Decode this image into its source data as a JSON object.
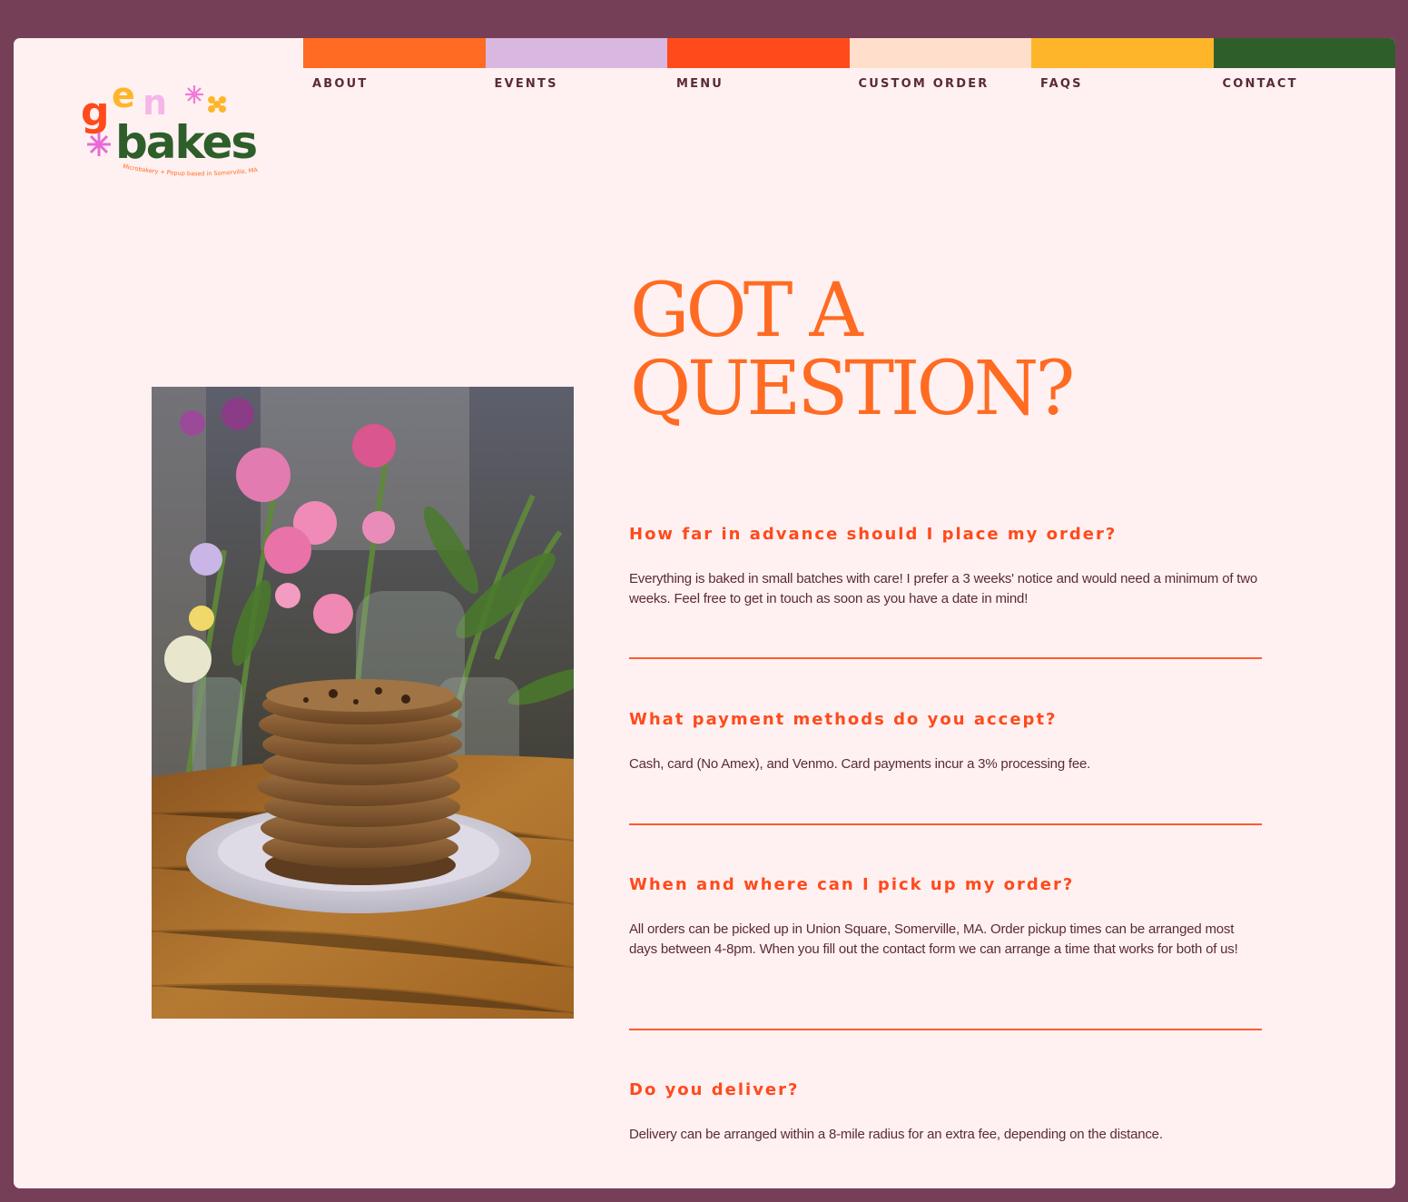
{
  "brand": {
    "logo_text": "gen bakes",
    "tagline": "Microbakery + Popup based in Somerville, MA"
  },
  "nav": {
    "items": [
      {
        "label": "ABOUT",
        "color": "#ff6b22"
      },
      {
        "label": "EVENTS",
        "color": "#d8b8e0"
      },
      {
        "label": "MENU",
        "color": "#ff4a1c"
      },
      {
        "label": "CUSTOM ORDER",
        "color": "#ffdfcc"
      },
      {
        "label": "FAQS",
        "color": "#ffb52a"
      },
      {
        "label": "CONTACT",
        "color": "#2e5e2a"
      }
    ]
  },
  "page": {
    "title_line1": "GOT A",
    "title_line2": "QUESTION?"
  },
  "faq": [
    {
      "question": "How far in advance should I place my order?",
      "answer": "Everything is baked in small batches with care! I prefer a 3 weeks' notice and would need a minimum of two weeks. Feel free to get in touch as soon as you have a date in mind!"
    },
    {
      "question": "What payment methods do you accept?",
      "answer": "Cash, card (No Amex), and Venmo. Card payments incur a 3% processing fee."
    },
    {
      "question": "When and where can I pick up my order?",
      "answer": "All orders can be picked up in Union Square, Somerville, MA. Order pickup times can be arranged most days between 4-8pm. When you fill out the contact form we can arrange a time that works for both of us!"
    },
    {
      "question": "Do you deliver?",
      "answer": "Delivery can be arranged within a 8-mile radius for an extra fee, depending on the distance."
    }
  ],
  "colors": {
    "background": "#fff1f1",
    "frame": "#763f58",
    "accent": "#ff6b22",
    "heading": "#ff4a1c",
    "text": "#5a2a38"
  }
}
